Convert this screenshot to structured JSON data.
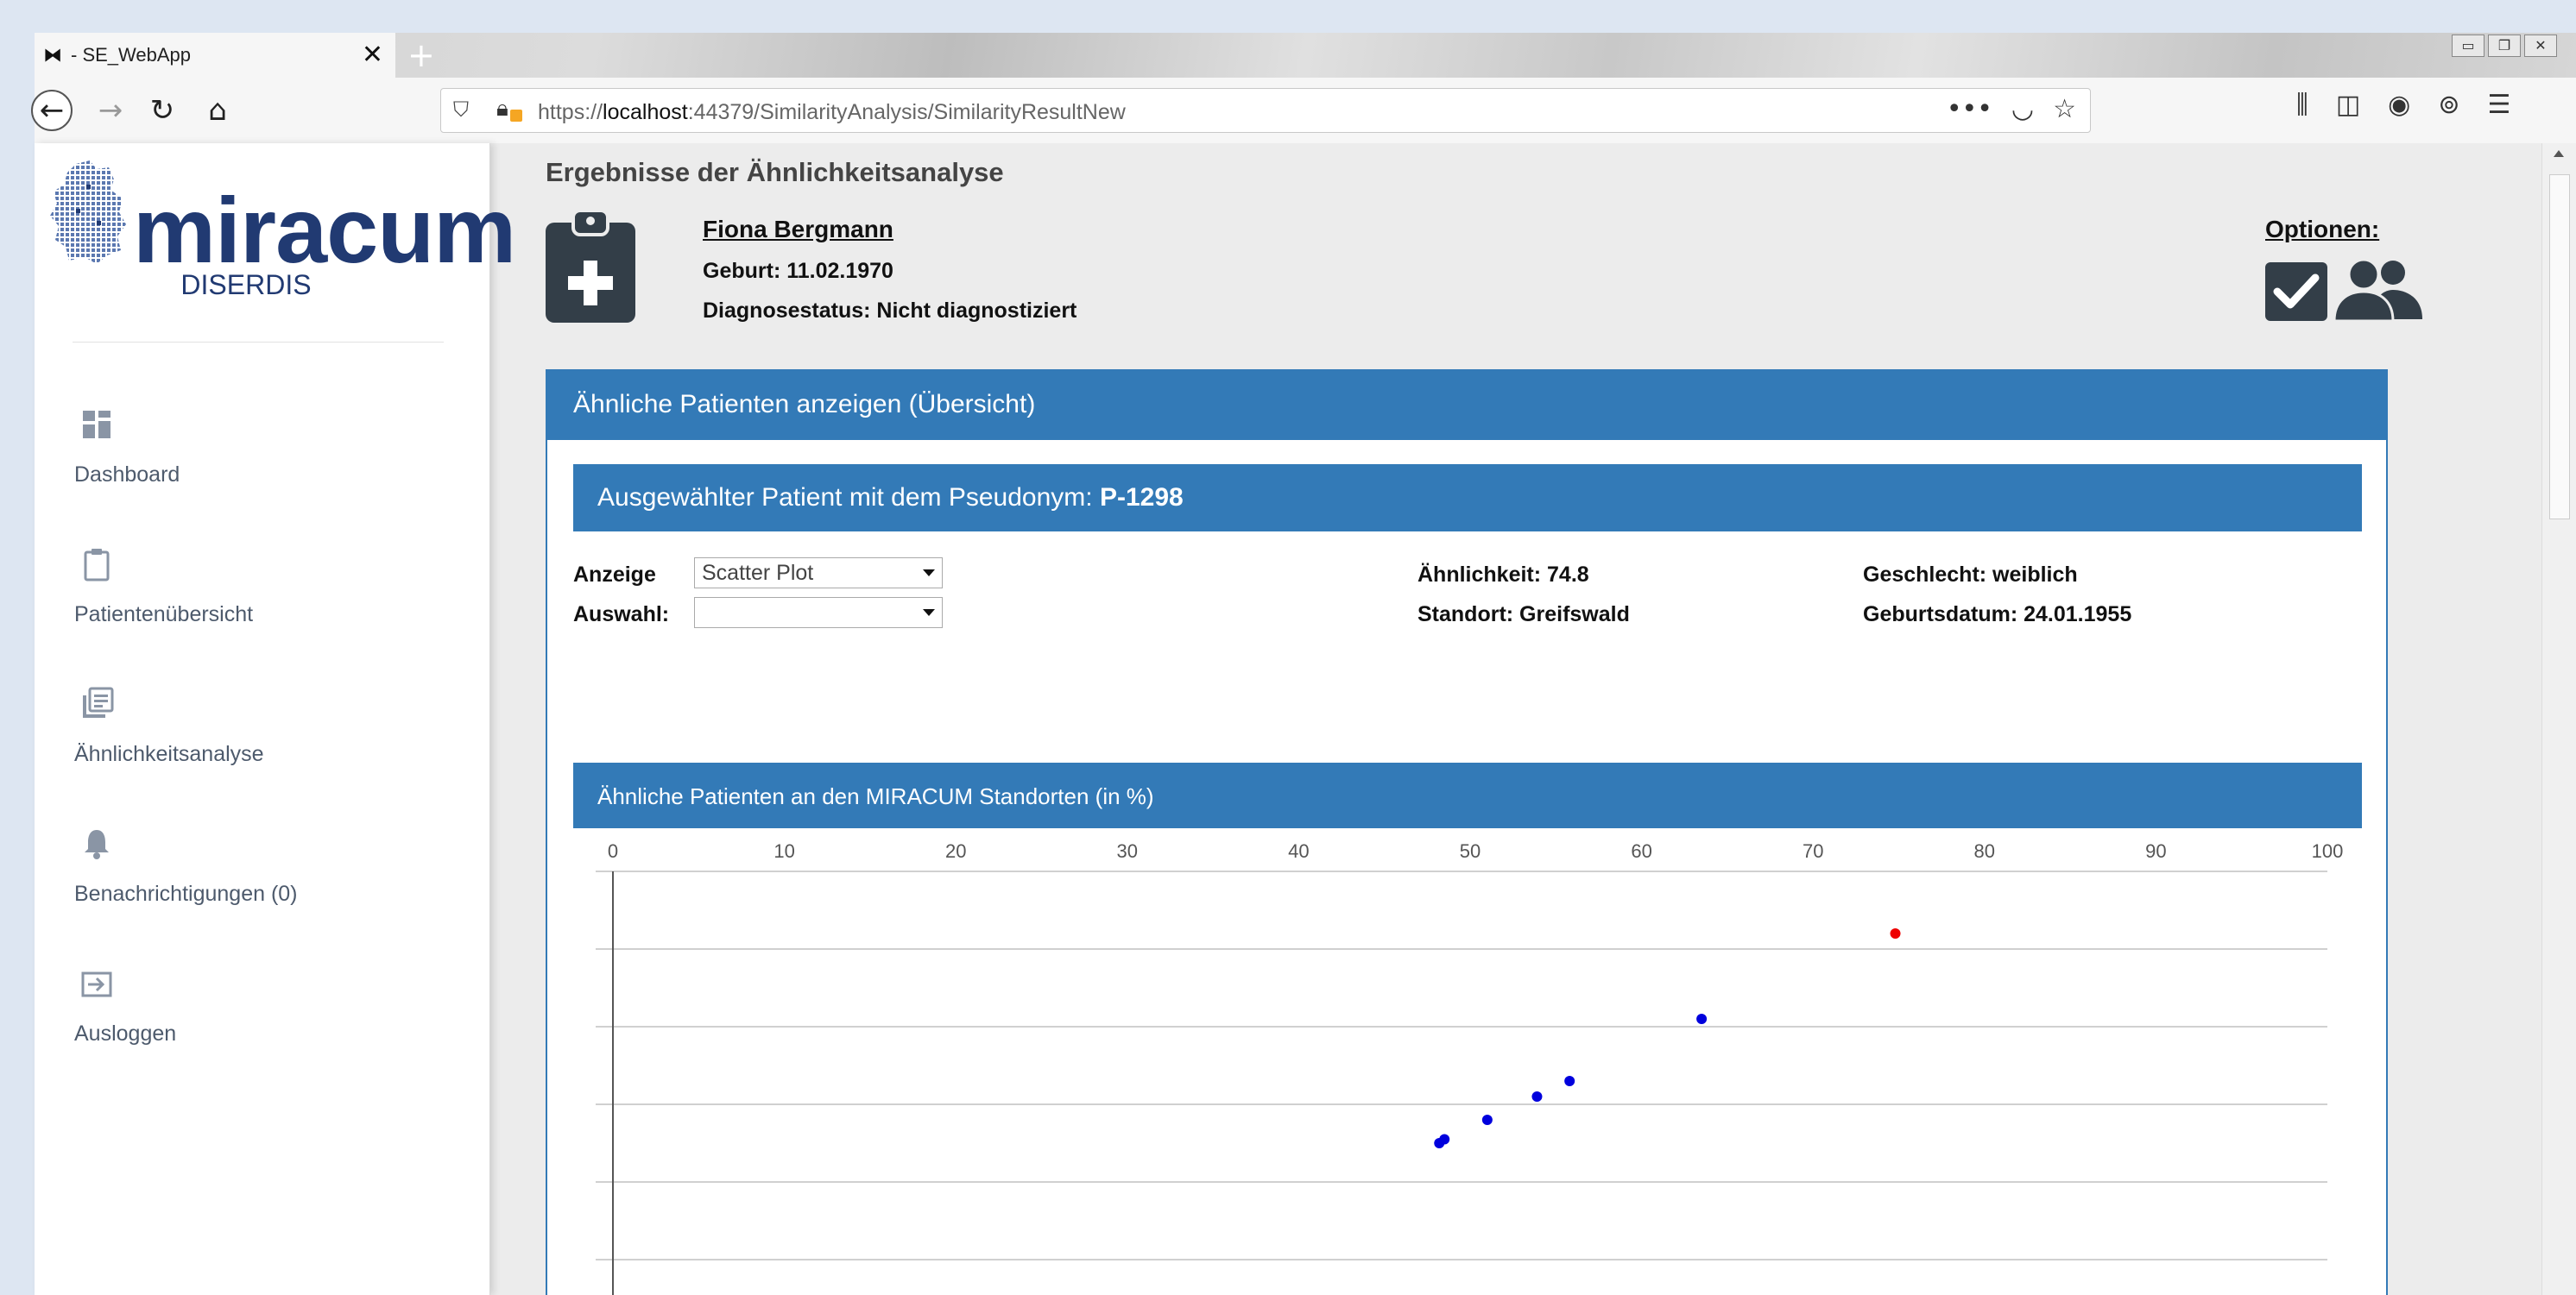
{
  "browser": {
    "tab_title": "- SE_WebApp",
    "tab_close": "✕",
    "new_tab": "+",
    "url_prefix": "https://",
    "url_host": "localhost",
    "url_rest": ":44379/SimilarityAnalysis/SimilarityResultNew",
    "page_actions": "•••"
  },
  "sidebar": {
    "brand": "miracum",
    "subtitle": "DISERDIS",
    "items": [
      {
        "label": "Dashboard",
        "icon": "dashboard-icon"
      },
      {
        "label": "Patientenübersicht",
        "icon": "clipboard-icon"
      },
      {
        "label": "Ähnlichkeitsanalyse",
        "icon": "library-icon"
      },
      {
        "label": "Benachrichtigungen (0)",
        "icon": "bell-icon"
      },
      {
        "label": "Ausloggen",
        "icon": "logout-icon"
      }
    ]
  },
  "header": {
    "title": "Ergebnisse der Ähnlichkeitsanalyse",
    "patient_name": "Fiona Bergmann",
    "birth": "Geburt: 11.02.1970",
    "diagnosis": "Diagnosestatus: Nicht diagnostiziert",
    "options_label": "Optionen:"
  },
  "panel": {
    "title": "Ähnliche Patienten anzeigen (Übersicht)",
    "selected_prefix": "Ausgewählter Patient mit dem Pseudonym:",
    "selected_pseudonym": "P-1298",
    "anzeige_label": "Anzeige",
    "anzeige_value": "Scatter Plot",
    "auswahl_label": "Auswahl:",
    "auswahl_value": "",
    "similarity": "Ähnlichkeit: 74.8",
    "location": "Standort: Greifswald",
    "sex": "Geschlecht: weiblich",
    "dob": "Geburtsdatum: 24.01.1955",
    "chart_title": "Ähnliche Patienten an den MIRACUM Standorten (in %)"
  },
  "colors": {
    "primary": "#337ab7",
    "brand": "#213a72",
    "point_selected": "#ee0000",
    "point_other": "#0000dd"
  },
  "chart_data": {
    "type": "scatter",
    "title": "Ähnliche Patienten an den MIRACUM Standorten (in %)",
    "xlim": [
      0,
      100
    ],
    "x_ticks": [
      "0",
      "10",
      "20",
      "30",
      "40",
      "50",
      "60",
      "70",
      "80",
      "90",
      "100"
    ],
    "x_axis_position": "top",
    "grid": "horizontal",
    "series": [
      {
        "role": "selected",
        "color": "#ee0000",
        "points": [
          {
            "x": 74.8,
            "y": 5.2
          }
        ]
      },
      {
        "role": "other",
        "color": "#0000dd",
        "points": [
          {
            "x": 63.5,
            "y": 4.1
          },
          {
            "x": 55.8,
            "y": 3.3
          },
          {
            "x": 53.9,
            "y": 3.1
          },
          {
            "x": 51.0,
            "y": 2.8
          },
          {
            "x": 48.5,
            "y": 2.55
          },
          {
            "x": 48.2,
            "y": 2.5
          }
        ]
      }
    ]
  }
}
